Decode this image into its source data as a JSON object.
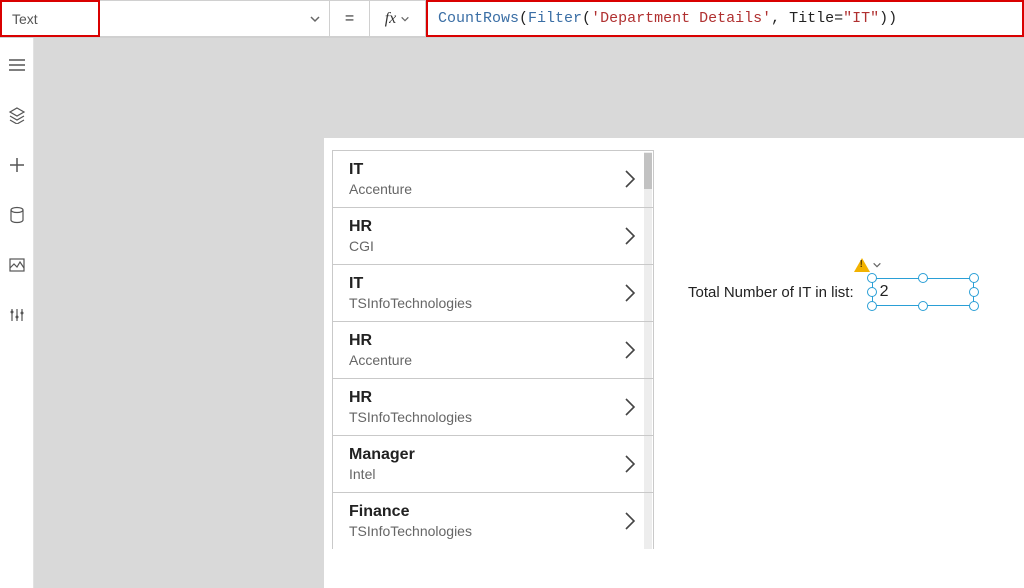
{
  "formula_bar": {
    "property": "Text",
    "equals": "=",
    "fx": "fx",
    "formula_tokens": {
      "fn1": "CountRows",
      "op1": "(",
      "fn2": "Filter",
      "op2": "(",
      "str1": "'Department Details'",
      "comma": ", ",
      "argname": "Title",
      "eq": "=",
      "str2": "\"IT\"",
      "close": "))"
    }
  },
  "rail": {
    "icons": [
      "tree-icon",
      "layers-icon",
      "plus-icon",
      "data-icon",
      "media-icon",
      "settings-icon"
    ]
  },
  "gallery": {
    "items": [
      {
        "title": "IT",
        "subtitle": "Accenture"
      },
      {
        "title": "HR",
        "subtitle": "CGI"
      },
      {
        "title": "IT",
        "subtitle": "TSInfoTechnologies"
      },
      {
        "title": "HR",
        "subtitle": "Accenture"
      },
      {
        "title": "HR",
        "subtitle": "TSInfoTechnologies"
      },
      {
        "title": "Manager",
        "subtitle": "Intel"
      },
      {
        "title": "Finance",
        "subtitle": "TSInfoTechnologies"
      }
    ]
  },
  "result": {
    "label": "Total Number of IT in list:",
    "value": "2"
  }
}
